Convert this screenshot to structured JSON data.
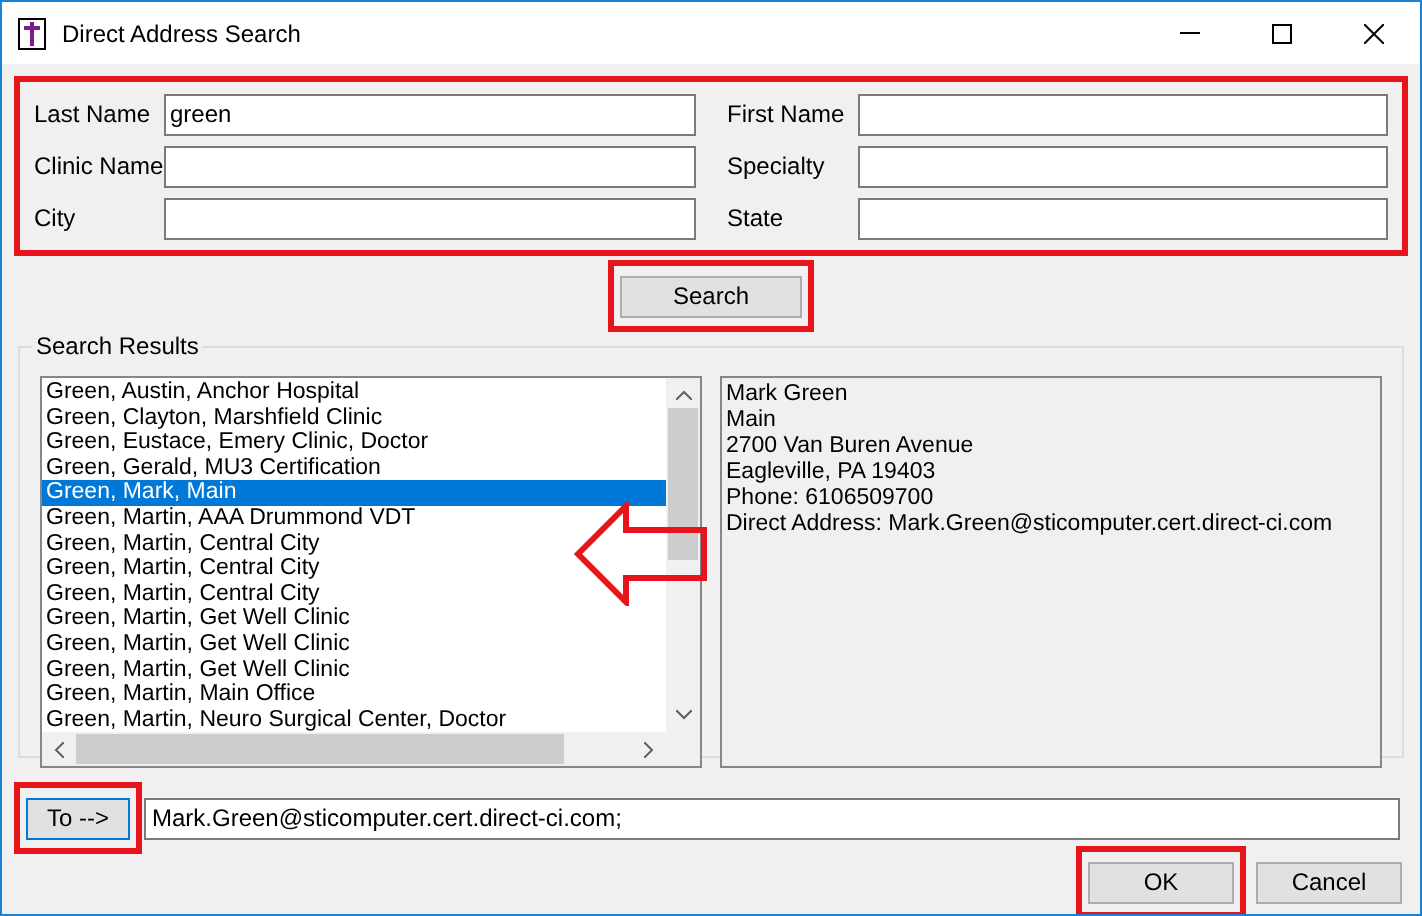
{
  "window": {
    "title": "Direct Address Search"
  },
  "form": {
    "highlighted": true,
    "fields": [
      {
        "label": "Last Name",
        "value": "green"
      },
      {
        "label": "First Name"
      },
      {
        "label": "Clinic Name"
      },
      {
        "label": "Specialty"
      },
      {
        "label": "City"
      },
      {
        "label": "State"
      }
    ]
  },
  "search_button": {
    "label": "Search",
    "highlighted": true
  },
  "results": {
    "title": "Search Results",
    "items": [
      {
        "text": "Green, Austin, Anchor Hospital",
        "selected": false
      },
      {
        "text": "Green, Clayton, Marshfield Clinic",
        "selected": false
      },
      {
        "text": "Green, Eustace, Emery Clinic, Doctor",
        "selected": false
      },
      {
        "text": "Green, Gerald, MU3 Certification",
        "selected": false
      },
      {
        "text": "Green, Mark, Main",
        "selected": true
      },
      {
        "text": "Green, Martin, AAA Drummond VDT",
        "selected": false
      },
      {
        "text": "Green, Martin, Central City",
        "selected": false
      },
      {
        "text": "Green, Martin, Central City",
        "selected": false
      },
      {
        "text": "Green, Martin, Central City",
        "selected": false
      },
      {
        "text": "Green, Martin, Get Well Clinic",
        "selected": false
      },
      {
        "text": "Green, Martin, Get Well Clinic",
        "selected": false
      },
      {
        "text": "Green, Martin, Get Well Clinic",
        "selected": false
      },
      {
        "text": "Green, Martin, Main Office",
        "selected": false
      },
      {
        "text": "Green, Martin, Neuro Surgical Center, Doctor",
        "selected": false
      }
    ],
    "details": [
      "Mark Green",
      "Main",
      "2700 Van Buren Avenue",
      "Eagleville, PA 19403",
      "Phone: 6106509700",
      "Direct Address: Mark.Green@sticomputer.cert.direct-ci.com"
    ]
  },
  "to_button": {
    "label": "To -->",
    "highlighted": true
  },
  "to_field": {
    "value": "Mark.Green@sticomputer.cert.direct-ci.com;"
  },
  "buttons": [
    {
      "label": "OK",
      "highlighted": true
    },
    {
      "label": "Cancel",
      "highlighted": false
    }
  ],
  "annotations": [
    {
      "kind": "arrow"
    }
  ]
}
